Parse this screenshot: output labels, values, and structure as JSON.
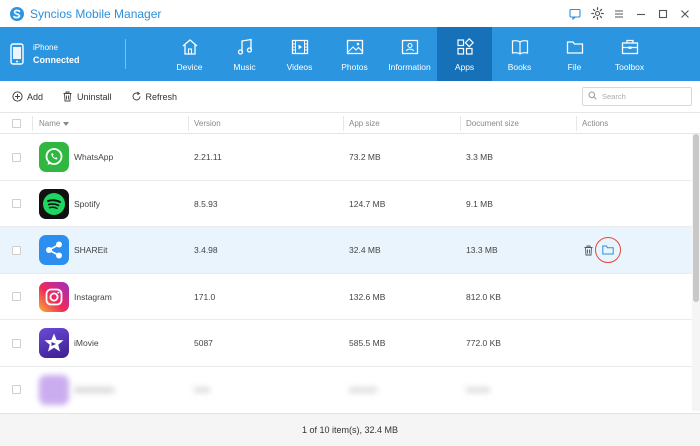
{
  "app": {
    "title": "Syncios Mobile Manager"
  },
  "device": {
    "name": "iPhone",
    "status": "Connected"
  },
  "nav": [
    {
      "label": "Device",
      "icon": "home-icon"
    },
    {
      "label": "Music",
      "icon": "music-icon"
    },
    {
      "label": "Videos",
      "icon": "film-icon"
    },
    {
      "label": "Photos",
      "icon": "image-icon"
    },
    {
      "label": "Information",
      "icon": "contact-card-icon"
    },
    {
      "label": "Apps",
      "icon": "apps-grid-icon",
      "active": true
    },
    {
      "label": "Books",
      "icon": "book-icon"
    },
    {
      "label": "File",
      "icon": "folder-icon"
    },
    {
      "label": "Toolbox",
      "icon": "toolbox-icon"
    }
  ],
  "actions": {
    "add": "Add",
    "uninstall": "Uninstall",
    "refresh": "Refresh"
  },
  "search": {
    "placeholder": "Search"
  },
  "table": {
    "headers": {
      "name": "Name",
      "version": "Version",
      "app_size": "App size",
      "document_size": "Document size",
      "actions": "Actions"
    },
    "rows": [
      {
        "name": "WhatsApp",
        "version": "2.21.11",
        "app_size": "73.2 MB",
        "document_size": "3.3 MB",
        "icon": "whatsapp-icon"
      },
      {
        "name": "Spotify",
        "version": "8.5.93",
        "app_size": "124.7 MB",
        "document_size": "9.1 MB",
        "icon": "spotify-icon"
      },
      {
        "name": "SHAREit",
        "version": "3.4.98",
        "app_size": "32.4 MB",
        "document_size": "13.3 MB",
        "icon": "shareit-icon",
        "selected": true
      },
      {
        "name": "Instagram",
        "version": "171.0",
        "app_size": "132.6 MB",
        "document_size": "812.0 KB",
        "icon": "instagram-icon"
      },
      {
        "name": "iMovie",
        "version": "5087",
        "app_size": "585.5 MB",
        "document_size": "772.0 KB",
        "icon": "imovie-icon"
      }
    ]
  },
  "status": {
    "summary": "1 of 10 item(s), 32.4 MB"
  },
  "colors": {
    "brand": "#2b95e0",
    "active_tab": "#1771b8",
    "selected_row": "#e9f4fd",
    "highlight": "#e0483a"
  }
}
